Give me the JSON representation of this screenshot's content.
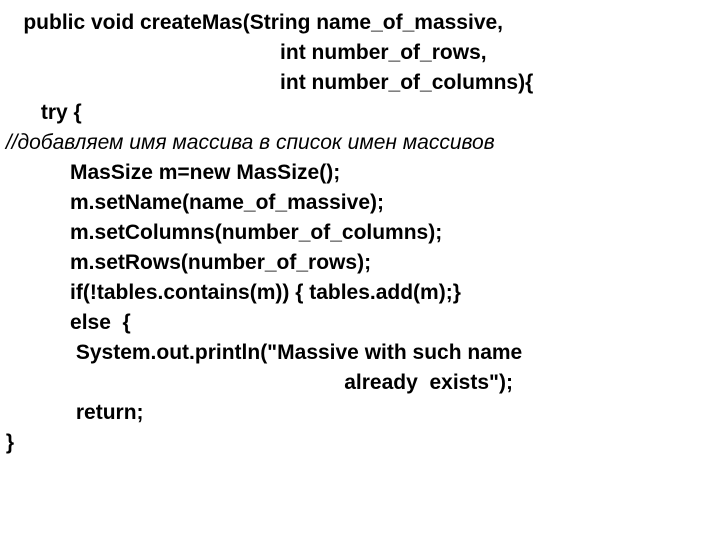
{
  "code": {
    "l1": "    public void createMas(String name_of_massive,",
    "l2": "                                                int number_of_rows,",
    "l3": "                                                int number_of_columns){",
    "l4": "       try {",
    "l5": " //добавляем имя массива в список имен массивов",
    "l6": "            MasSize m=new MasSize();",
    "l7": "            m.setName(name_of_massive);",
    "l8": "            m.setColumns(number_of_columns);",
    "l9": "            m.setRows(number_of_rows);",
    "l10": "            if(!tables.contains(m)) { tables.add(m);}",
    "l11": "            else  {",
    "l12": "             System.out.println(\"Massive with such name",
    "l13": "                                                           already  exists\");",
    "l14": "             return;",
    "l15": " }"
  }
}
